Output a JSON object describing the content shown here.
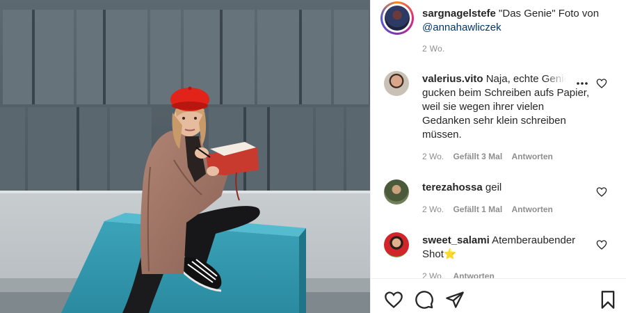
{
  "photo": {
    "subject": "Woman in red beret and trenchcoat sitting on turquoise block writing in red notebook"
  },
  "post": {
    "username": "sargnagelstefe",
    "caption_text": " \"Das Genie\" Foto von ",
    "mention": "@annahawliczek",
    "time": "2 Wo."
  },
  "comments": [
    {
      "username": "valerius.vito",
      "text": " Naja, echte Genies gucken beim Schreiben aufs Papier, weil sie wegen ihrer vielen Gedanken sehr klein schreiben müssen.",
      "time": "2 Wo.",
      "likes": "Gefällt 3 Mal",
      "reply": "Antworten"
    },
    {
      "username": "terezahossa",
      "text": " geil",
      "time": "2 Wo.",
      "likes": "Gefällt 1 Mal",
      "reply": "Antworten"
    },
    {
      "username": "sweet_salami",
      "text": " Atemberaubender Shot",
      "emoji": "⭐",
      "time": "2 Wo.",
      "likes": "",
      "reply": "Antworten"
    }
  ],
  "icons": {
    "like": "heart-icon",
    "comment": "comment-icon",
    "share": "share-icon",
    "save": "bookmark-icon",
    "more": "more-options-icon"
  },
  "colors": {
    "username": "#262626",
    "mention": "#00376b",
    "meta": "#8e8e8e",
    "story_ring": "#dd2a7b"
  }
}
